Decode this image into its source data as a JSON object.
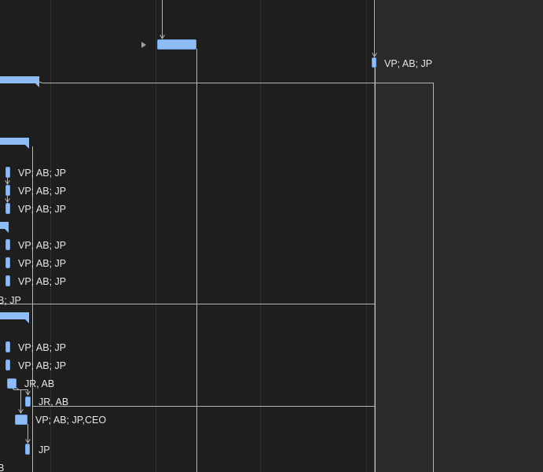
{
  "view": "Gantt chart timeline",
  "colors": {
    "background": "#1e1e1f",
    "weekend": "#2a2a2b",
    "bar": "#8fbcf5",
    "link": "#b4b4b8",
    "label": "#e6e6e6"
  },
  "tasks": [
    {
      "id": "t1",
      "label": ""
    },
    {
      "id": "t2",
      "label": "VP; AB; JP"
    },
    {
      "id": "s1",
      "label": ""
    },
    {
      "id": "s2",
      "label": ""
    },
    {
      "id": "t3",
      "label": "VP; AB; JP"
    },
    {
      "id": "t4",
      "label": "VP; AB; JP"
    },
    {
      "id": "t5",
      "label": "VP; AB; JP"
    },
    {
      "id": "s3",
      "label": ""
    },
    {
      "id": "t6",
      "label": "VP; AB; JP"
    },
    {
      "id": "t7",
      "label": "VP; AB; JP"
    },
    {
      "id": "t8",
      "label": "VP; AB; JP"
    },
    {
      "id": "t9",
      "label": "B; JP"
    },
    {
      "id": "s4",
      "label": ""
    },
    {
      "id": "t10",
      "label": "VP; AB; JP"
    },
    {
      "id": "t11",
      "label": "VP; AB; JP"
    },
    {
      "id": "t12",
      "label": "JR, AB"
    },
    {
      "id": "t13",
      "label": "JR, AB"
    },
    {
      "id": "t14",
      "label": "VP; AB; JP,CEO"
    },
    {
      "id": "t15",
      "label": "JP"
    },
    {
      "id": "t16",
      "label": "B"
    }
  ]
}
